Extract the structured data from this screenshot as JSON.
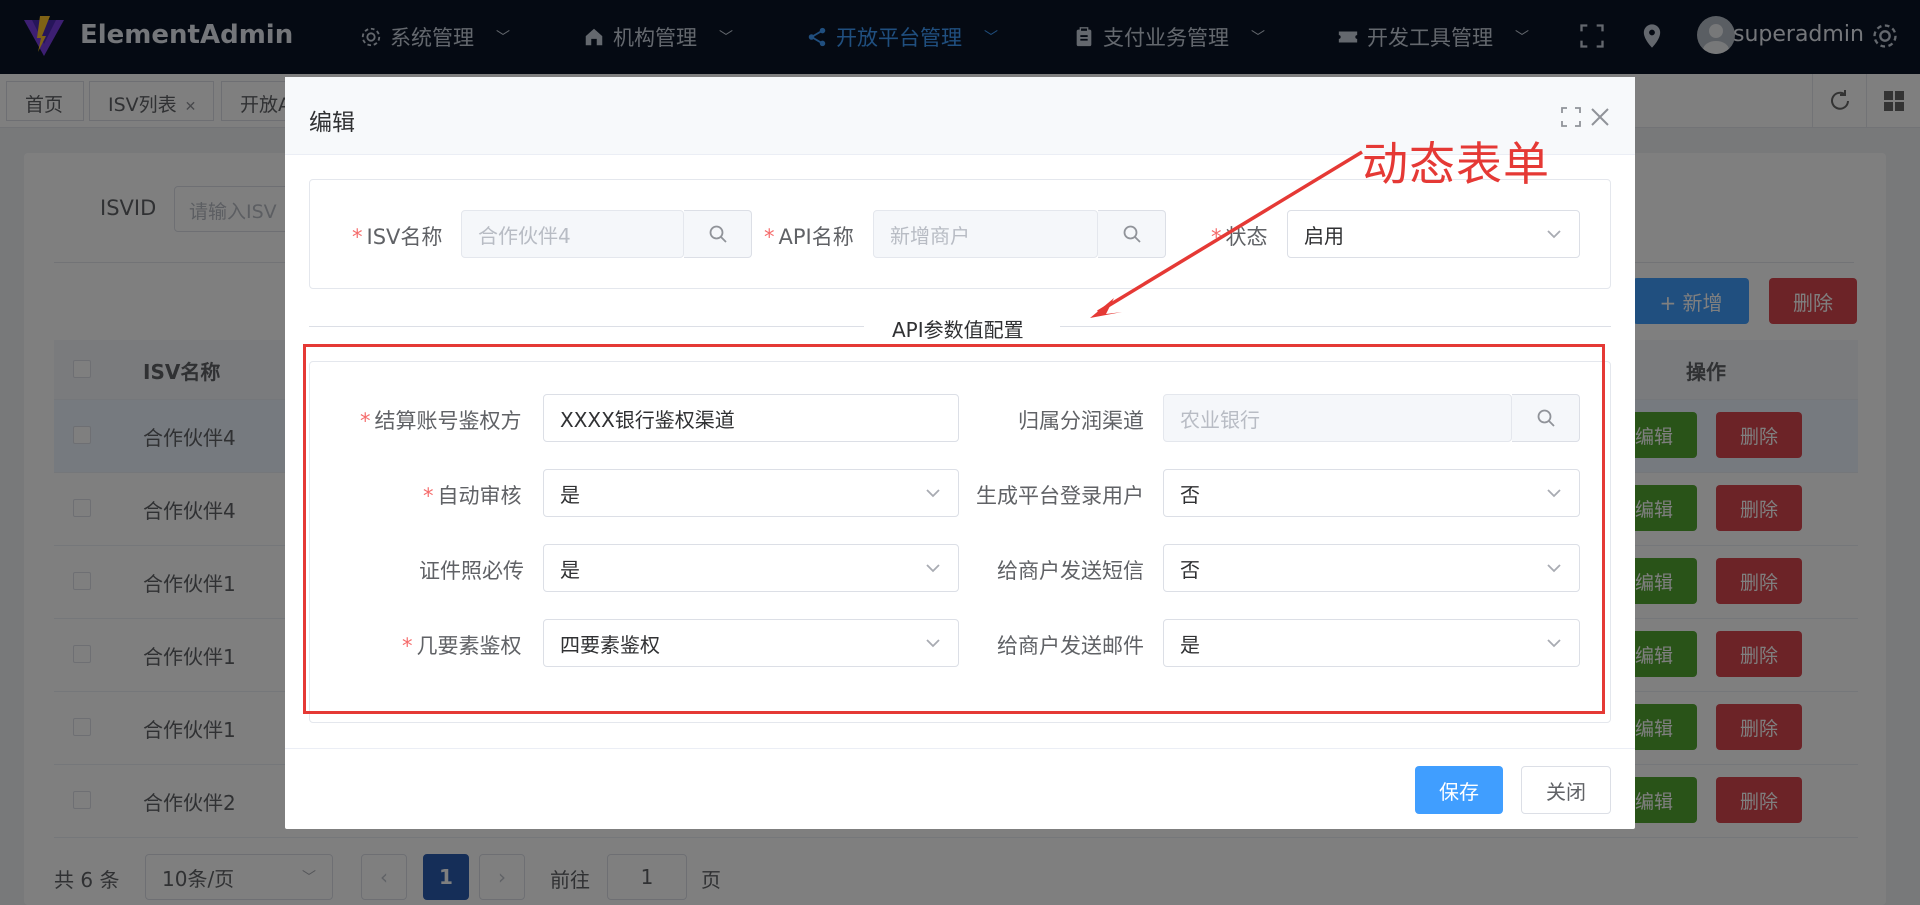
{
  "app": {
    "title": "ElementAdmin",
    "user": "superadmin"
  },
  "nav": [
    {
      "label": "系统管理",
      "icon": "gear-icon"
    },
    {
      "label": "机构管理",
      "icon": "home-icon"
    },
    {
      "label": "开放平台管理",
      "icon": "share-icon"
    },
    {
      "label": "支付业务管理",
      "icon": "clipboard-icon"
    },
    {
      "label": "开发工具管理",
      "icon": "ticket-icon"
    }
  ],
  "tags": [
    {
      "label": "首页"
    },
    {
      "label": "ISV列表"
    },
    {
      "label": "开放A"
    }
  ],
  "background": {
    "filter_label": "ISVID",
    "filter_placeholder": "请输入ISV",
    "add_button": "+ 新增",
    "delete_button": "删除",
    "columns": {
      "isv_name": "ISV名称",
      "actions": "操作"
    },
    "rows": [
      {
        "isv_name": "合作伙伴4"
      },
      {
        "isv_name": "合作伙伴4"
      },
      {
        "isv_name": "合作伙伴1"
      },
      {
        "isv_name": "合作伙伴1"
      },
      {
        "isv_name": "合作伙伴1"
      },
      {
        "isv_name": "合作伙伴2"
      }
    ],
    "row_edit": "编辑",
    "row_delete": "删除",
    "pager": {
      "total": "共 6 条",
      "page_size": "10条/页",
      "page": "1",
      "goto_prefix": "前往",
      "goto_value": "1",
      "goto_suffix": "页"
    }
  },
  "dialog": {
    "title": "编辑",
    "isv_label": "ISV名称",
    "isv_value": "合作伙伴4",
    "api_label": "API名称",
    "api_value": "新增商户",
    "status_label": "状态",
    "status_value": "启用",
    "section_title": "API参数值配置",
    "fields": {
      "settle_auth_label": "结算账号鉴权方",
      "settle_auth_value": "XXXX银行鉴权渠道",
      "profit_channel_label": "归属分润渠道",
      "profit_channel_value": "农业银行",
      "auto_review_label": "自动审核",
      "auto_review_value": "是",
      "gen_login_label": "生成平台登录用户",
      "gen_login_value": "否",
      "cert_required_label": "证件照必传",
      "cert_required_value": "是",
      "send_sms_label": "给商户发送短信",
      "send_sms_value": "否",
      "elements_auth_label": "几要素鉴权",
      "elements_auth_value": "四要素鉴权",
      "send_email_label": "给商户发送邮件",
      "send_email_value": "是"
    },
    "save_button": "保存",
    "close_button": "关闭"
  },
  "annotation": {
    "text": "动态表单",
    "color": "#e53935"
  },
  "colors": {
    "primary": "#409eff",
    "success": "#52a631",
    "danger": "#d9474f",
    "nav_bg": "#0b1526"
  }
}
